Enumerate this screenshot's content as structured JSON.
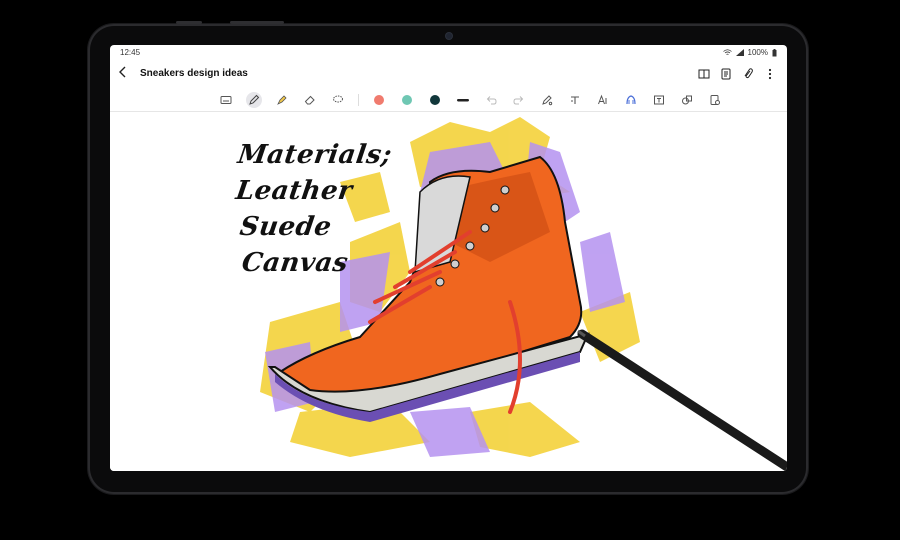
{
  "status_bar": {
    "time": "12:45",
    "battery": "100%"
  },
  "app_bar": {
    "title": "Sneakers design ideas"
  },
  "icons": {
    "back": "chevron-left-icon",
    "book": "book-icon",
    "note": "note-icon",
    "attach": "paperclip-icon",
    "more": "more-vert-icon"
  },
  "toolbar": {
    "colors": [
      "#f07b6e",
      "#6fc7b3",
      "#12373b"
    ],
    "active_tool": "pen"
  },
  "canvas": {
    "handwriting": [
      "Materials;",
      "Leather",
      "Suede",
      "Canvas"
    ]
  },
  "palette": {
    "shoe_orange": "#f0661f",
    "shoe_dark_orange": "#c94a12",
    "splash_yellow": "#f4d444",
    "splash_purple": "#b592f0",
    "pen_black": "#1a1a1a"
  }
}
